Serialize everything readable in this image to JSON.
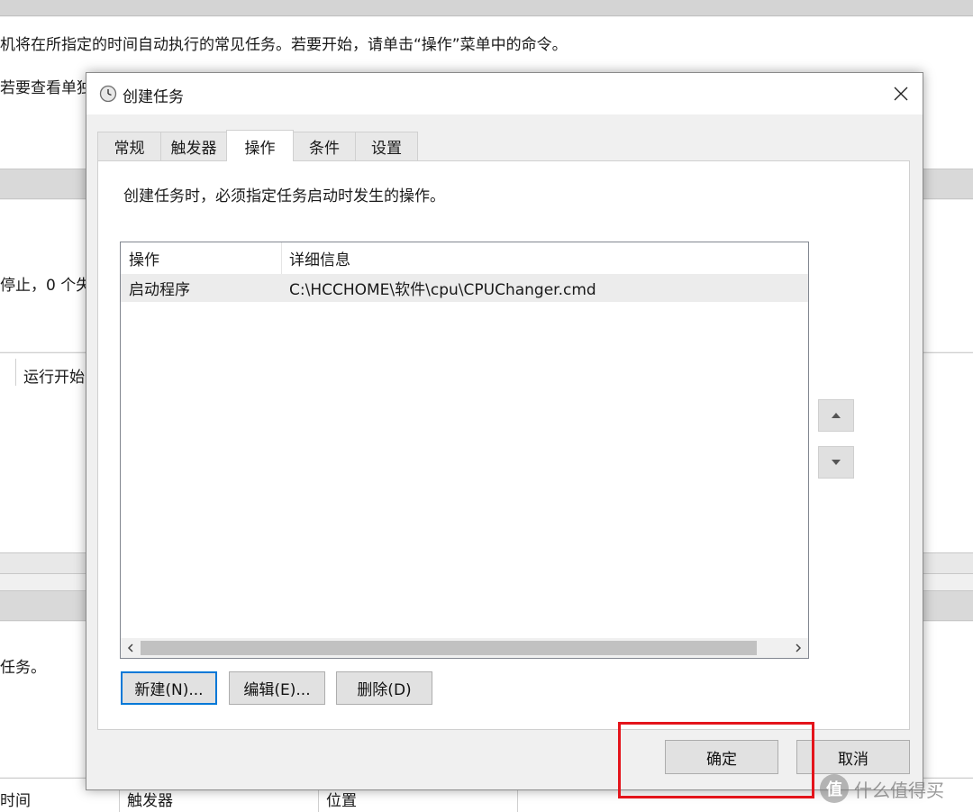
{
  "background": {
    "intro_line1": "机将在所指定的时间自动执行的常见任务。若要开始，请单击“操作”菜单中的命令。",
    "intro_line2": "若要查看单独",
    "status_text": "停止，0 个失",
    "column_run_start": "运行开始",
    "tasks_text": "任务。",
    "col_time": "时间",
    "col_trigger": "触发器",
    "col_location": "位置"
  },
  "dialog": {
    "title": "创建任务",
    "tabs": [
      {
        "label": "常规"
      },
      {
        "label": "触发器"
      },
      {
        "label": "操作",
        "active": true
      },
      {
        "label": "条件"
      },
      {
        "label": "设置"
      }
    ],
    "description": "创建任务时，必须指定任务启动时发生的操作。",
    "list": {
      "columns": [
        "操作",
        "详细信息"
      ],
      "rows": [
        {
          "action": "启动程序",
          "details": "C:\\HCCHOME\\软件\\cpu\\CPUChanger.cmd"
        }
      ]
    },
    "buttons": {
      "new": "新建(N)...",
      "edit": "编辑(E)...",
      "delete": "删除(D)",
      "ok": "确定",
      "cancel": "取消"
    }
  },
  "watermark": {
    "logo": "值",
    "text": "什么值得买"
  },
  "colors": {
    "focus_blue": "#0078d7",
    "highlight_red": "#e4141b"
  }
}
